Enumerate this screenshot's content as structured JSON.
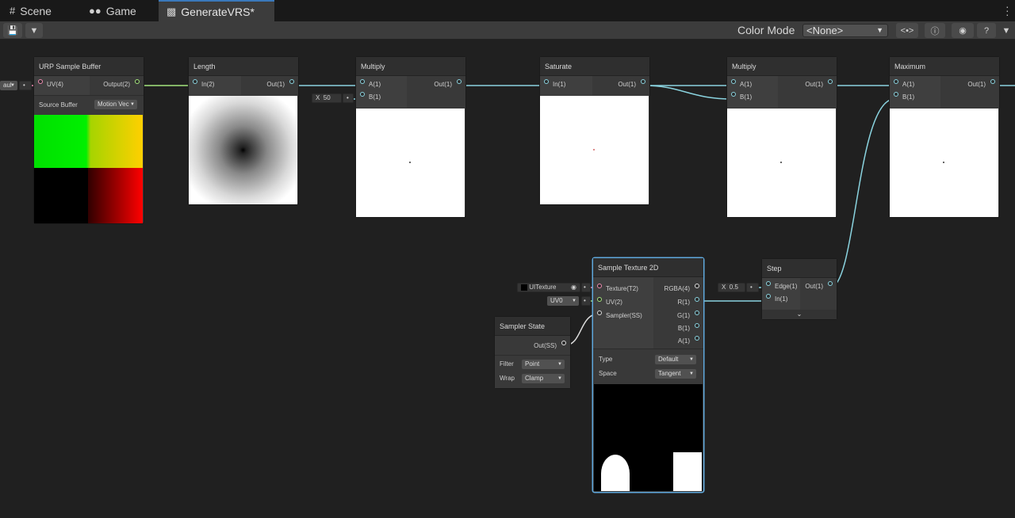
{
  "tabs": [
    {
      "label": "Scene",
      "icon": "grid-icon"
    },
    {
      "label": "Game",
      "icon": "gamepad-icon"
    },
    {
      "label": "GenerateVRS*",
      "icon": "shader-graph-icon"
    }
  ],
  "toolbar": {
    "color_mode_label": "Color Mode",
    "color_mode_value": "<None>"
  },
  "nodes": {
    "urp_sample_buffer": {
      "title": "URP Sample Buffer",
      "in_uv": "UV(4)",
      "out": "Output(2)",
      "source_buffer_label": "Source Buffer",
      "source_buffer_value": "Motion Vec",
      "left_default": "aul"
    },
    "length": {
      "title": "Length",
      "in": "In(2)",
      "out": "Out(1)"
    },
    "multiply1": {
      "title": "Multiply",
      "in_a": "A(1)",
      "in_b": "B(1)",
      "out": "Out(1)",
      "b_label": "X",
      "b_value": "50"
    },
    "saturate": {
      "title": "Saturate",
      "in": "In(1)",
      "out": "Out(1)"
    },
    "multiply2": {
      "title": "Multiply",
      "in_a": "A(1)",
      "in_b": "B(1)",
      "out": "Out(1)"
    },
    "maximum": {
      "title": "Maximum",
      "in_a": "A(1)",
      "in_b": "B(1)",
      "out": "Out(1)"
    },
    "sample_texture": {
      "title": "Sample Texture 2D",
      "in_texture": "Texture(T2)",
      "in_uv": "UV(2)",
      "in_sampler": "Sampler(SS)",
      "out_rgba": "RGBA(4)",
      "out_r": "R(1)",
      "out_g": "G(1)",
      "out_b": "B(1)",
      "out_a": "A(1)",
      "type_label": "Type",
      "type_value": "Default",
      "space_label": "Space",
      "space_value": "Tangent",
      "texture_field": "UITexture",
      "uv_field": "UV0"
    },
    "sampler_state": {
      "title": "Sampler State",
      "out": "Out(SS)",
      "filter_label": "Filter",
      "filter_value": "Point",
      "wrap_label": "Wrap",
      "wrap_value": "Clamp"
    },
    "step": {
      "title": "Step",
      "in_edge": "Edge(1)",
      "in_in": "In(1)",
      "out": "Out(1)",
      "edge_label": "X",
      "edge_value": "0.5"
    }
  },
  "colors": {
    "wire_float": "#8ad3df",
    "wire_vec2": "#a4e57d",
    "selected": "#5fa8dc"
  }
}
